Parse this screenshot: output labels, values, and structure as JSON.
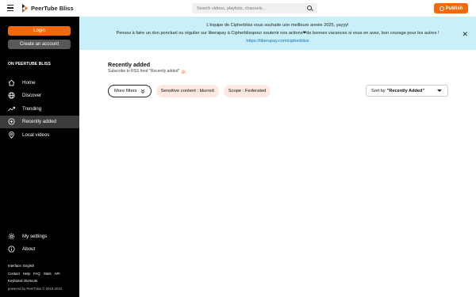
{
  "header": {
    "app_name": "PeerTube Bliss",
    "search_placeholder": "Search videos, playlists, channels…",
    "publish_label": "Publish"
  },
  "sidebar": {
    "login_label": "Login",
    "create_account_label": "Create an account",
    "section_title": "ON PEERTUBE BLISS",
    "items": [
      {
        "label": "Home",
        "icon": "home-icon"
      },
      {
        "label": "Discover",
        "icon": "globe-icon"
      },
      {
        "label": "Trending",
        "icon": "trending-icon"
      },
      {
        "label": "Recently added",
        "icon": "plus-circle-icon",
        "active": true
      },
      {
        "label": "Local videos",
        "icon": "location-icon"
      }
    ],
    "bottom_items": [
      {
        "label": "My settings",
        "icon": "gear-icon"
      },
      {
        "label": "About",
        "icon": "info-icon"
      }
    ],
    "footer": {
      "interface": "Interface: English",
      "links": [
        "Contact",
        "Help",
        "FAQ",
        "Stats",
        "API"
      ],
      "shortcuts": "Keyboard shortcuts",
      "powered": "powered by PeerTube © 2015-2022"
    }
  },
  "banner": {
    "line1": "L'équipe de Cipherbliss vous souhaite une meilleure année 2025, yayyy!",
    "line2": "Pensez à faire un don ponctuel ou régulier sur liberapay à Cipherblisspour soutenir nos actions❤de bonnes vacances si vous en avez, bon courage pour les autres !",
    "line3": "https://liberapay.com/cipherbliss",
    "close": "✕"
  },
  "main": {
    "title": "Recently added",
    "rss_text": "Subscribe to RSS feed \"Recently added\"",
    "more_filters": "More filters",
    "chips": [
      "Sensitive content : blurred",
      "Scope : Federated"
    ],
    "sort_prefix": "Sort by",
    "sort_value": "\"Recently Added\""
  },
  "colors": {
    "accent": "#f1680d",
    "sidebar_bg": "#000000",
    "banner_bg": "#c9f0f8",
    "chip_bg": "#fde9df"
  }
}
